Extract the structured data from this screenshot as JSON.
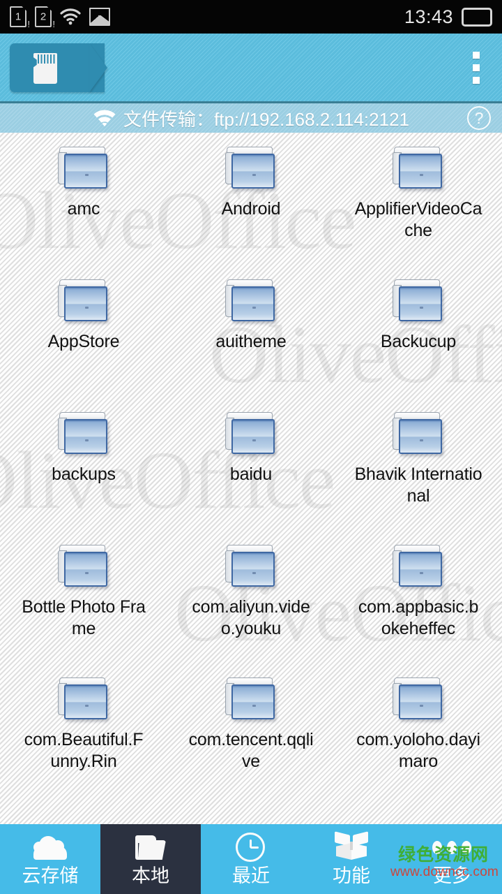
{
  "status_bar": {
    "sim1_label": "1",
    "sim2_label": "2",
    "wifi_icon": "wifi-icon",
    "image_icon": "image-icon",
    "time": "13:43",
    "battery_icon": "battery-icon"
  },
  "header": {
    "breadcrumb_icon": "sdcard-icon",
    "breadcrumb_label": "",
    "overflow_icon": "overflow-menu-icon"
  },
  "ftp_bar": {
    "wifi_icon": "wifi-icon",
    "text": "文件传输：ftp://192.168.2.114:2121",
    "help_label": "?"
  },
  "content": {
    "watermark_text": "OliveOffice",
    "folder_icon": "folder-icon",
    "items": [
      {
        "label": "amc"
      },
      {
        "label": "Android"
      },
      {
        "label": "ApplifierVideoCache"
      },
      {
        "label": "AppStore"
      },
      {
        "label": "auitheme"
      },
      {
        "label": "Backucup"
      },
      {
        "label": "backups"
      },
      {
        "label": "baidu"
      },
      {
        "label": "Bhavik International"
      },
      {
        "label": "Bottle Photo Frame"
      },
      {
        "label": "com.aliyun.video.youku"
      },
      {
        "label": "com.appbasic.bokeheffec"
      },
      {
        "label": "com.Beautiful.Funny.Rin"
      },
      {
        "label": "com.tencent.qqlive"
      },
      {
        "label": "com.yoloho.dayimaro"
      }
    ]
  },
  "bottom_nav": {
    "items": [
      {
        "label": "云存储",
        "icon": "cloud-icon",
        "active": false
      },
      {
        "label": "本地",
        "icon": "folder-open-icon",
        "active": true
      },
      {
        "label": "最近",
        "icon": "clock-icon",
        "active": false
      },
      {
        "label": "功能",
        "icon": "open-box-icon",
        "active": false
      },
      {
        "label": "更多",
        "icon": "three-dots-icon",
        "active": false
      }
    ]
  },
  "site_watermark": {
    "cn": "绿色资源网",
    "url": "www.downcc.com"
  },
  "colors": {
    "header_blue": "#5ec2e3",
    "ftp_blue": "#9ed2e6",
    "nav_blue": "#45bbe8",
    "nav_active": "#2b3140",
    "breadcrumb_tag": "#2f8cb0",
    "status_bg": "#050505"
  }
}
